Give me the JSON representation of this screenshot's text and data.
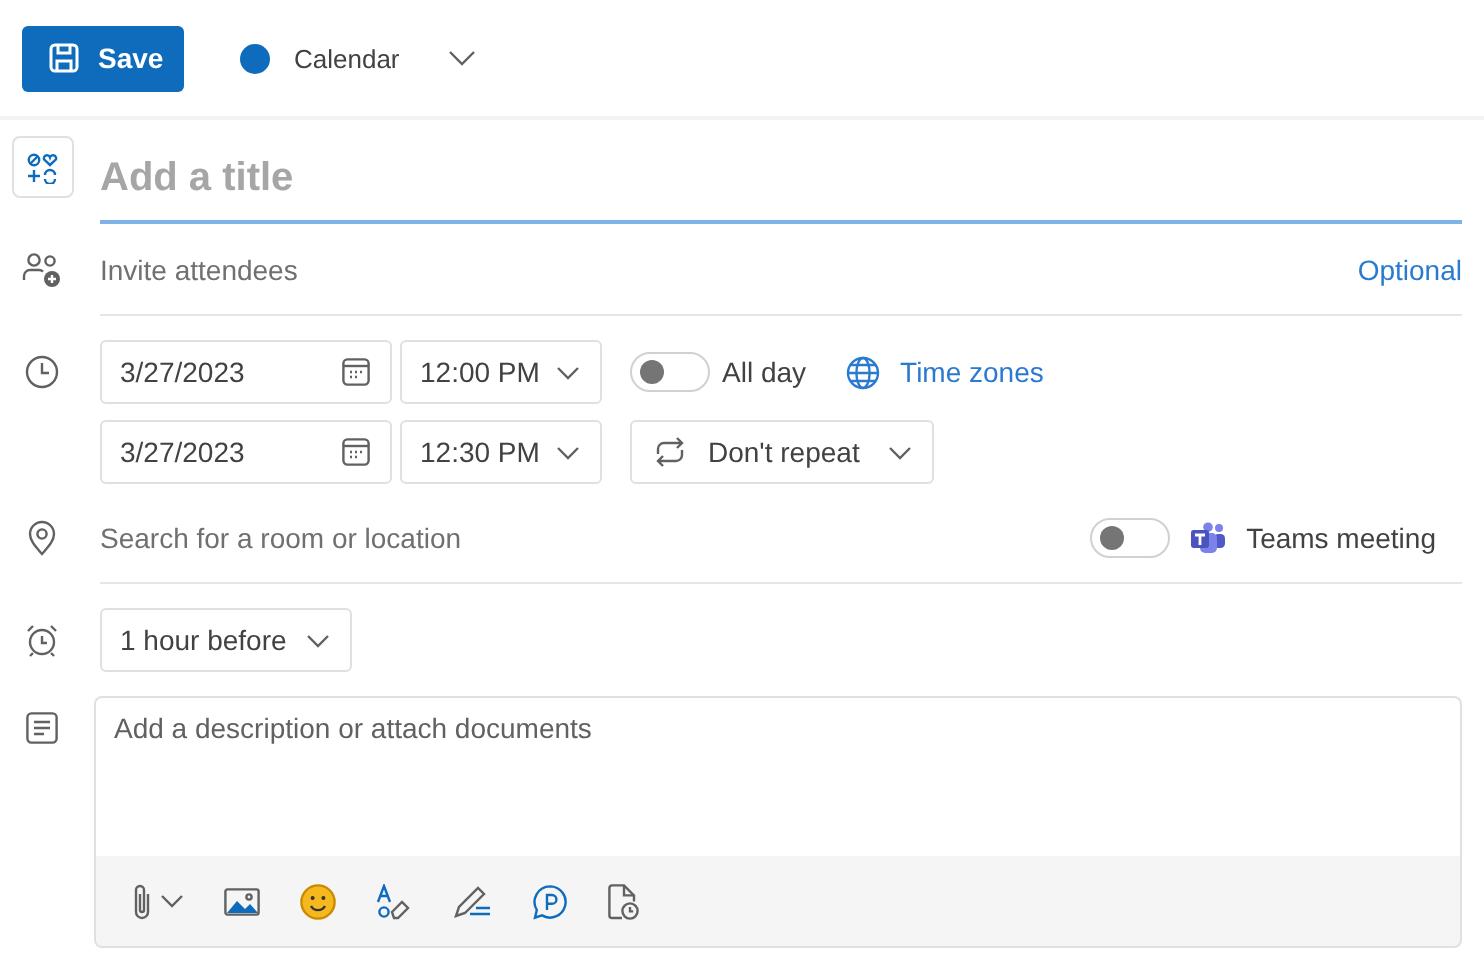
{
  "toolbar": {
    "save_button": "Save",
    "calendar": {
      "name": "Calendar",
      "color": "#0f6cbd"
    }
  },
  "title": {
    "placeholder": "Add a title"
  },
  "attendees": {
    "placeholder": "Invite attendees",
    "optional_link": "Optional"
  },
  "start": {
    "date": "3/27/2023",
    "time": "12:00 PM"
  },
  "end": {
    "date": "3/27/2023",
    "time": "12:30 PM"
  },
  "all_day": {
    "label": "All day",
    "on": false
  },
  "time_zones": "Time zones",
  "repeat": "Don't repeat",
  "location": {
    "placeholder": "Search for a room or location"
  },
  "teams_meeting": {
    "label": "Teams meeting",
    "on": false
  },
  "reminder": "1 hour before",
  "description": {
    "placeholder": "Add a description or attach documents"
  }
}
